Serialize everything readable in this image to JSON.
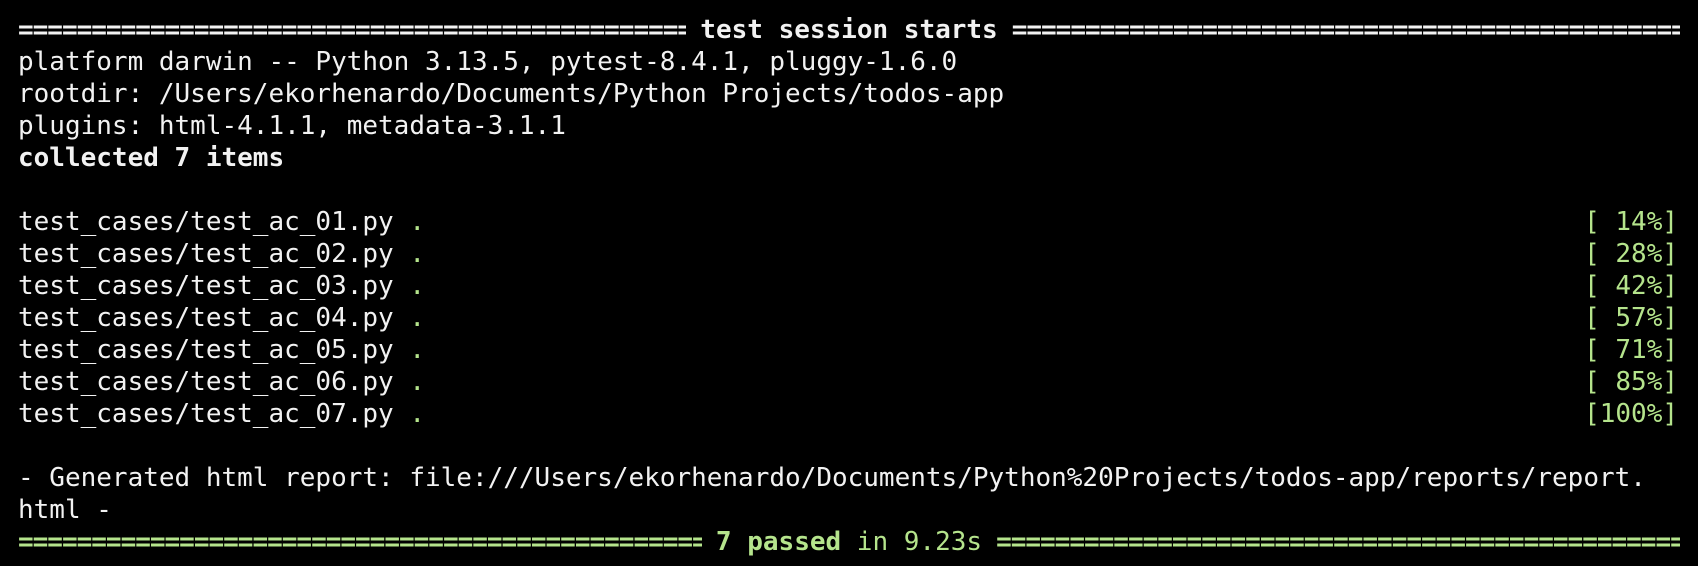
{
  "header": {
    "fill": "========================================================================================================",
    "title": "test session starts"
  },
  "info": {
    "platform": "platform darwin -- Python 3.13.5, pytest-8.4.1, pluggy-1.6.0",
    "rootdir": "rootdir: /Users/ekorhenardo/Documents/Python Projects/todos-app",
    "plugins": "plugins: html-4.1.1, metadata-3.1.1",
    "collected": "collected 7 items"
  },
  "tests": [
    {
      "file": "test_cases/test_ac_01.py",
      "result": ".",
      "progress": "[ 14%]"
    },
    {
      "file": "test_cases/test_ac_02.py",
      "result": ".",
      "progress": "[ 28%]"
    },
    {
      "file": "test_cases/test_ac_03.py",
      "result": ".",
      "progress": "[ 42%]"
    },
    {
      "file": "test_cases/test_ac_04.py",
      "result": ".",
      "progress": "[ 57%]"
    },
    {
      "file": "test_cases/test_ac_05.py",
      "result": ".",
      "progress": "[ 71%]"
    },
    {
      "file": "test_cases/test_ac_06.py",
      "result": ".",
      "progress": "[ 85%]"
    },
    {
      "file": "test_cases/test_ac_07.py",
      "result": ".",
      "progress": "[100%]"
    }
  ],
  "report": {
    "line1": "- Generated html report: file:///Users/ekorhenardo/Documents/Python%20Projects/todos-app/reports/report.",
    "line2": "html -"
  },
  "footer": {
    "fill": "========================================================================================================",
    "passed": "7 passed",
    "in_text": " in ",
    "duration": "9.23s"
  },
  "colors": {
    "background": "#000000",
    "text": "#f2f2f2",
    "pass_green": "#b5e48c"
  }
}
